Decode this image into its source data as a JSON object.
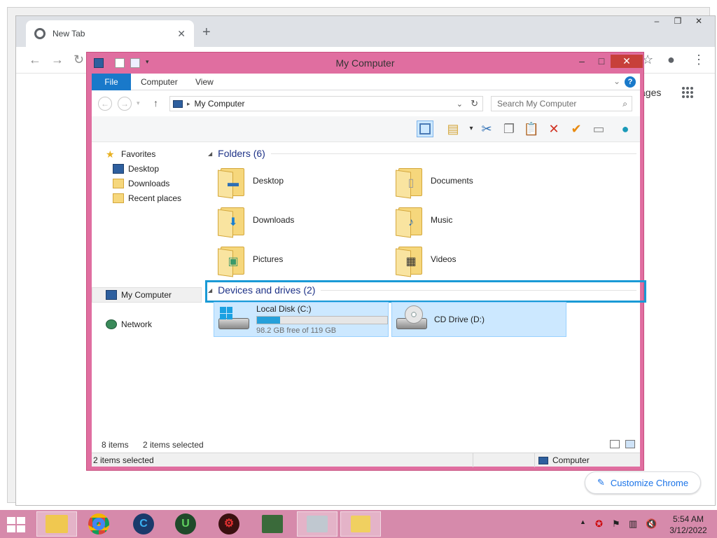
{
  "chrome": {
    "tab_title": "New Tab",
    "new_tab_symbol": "+",
    "gmail_partial": "ages",
    "customize_label": "Customize Chrome",
    "window_controls": [
      "–",
      "❐",
      "✕"
    ]
  },
  "explorer": {
    "title": "My Computer",
    "title_controls": {
      "minimize": "–",
      "maximize": "□",
      "close": "✕"
    },
    "ribbon_tabs": [
      "File",
      "Computer",
      "View"
    ],
    "help_label": "?",
    "address": {
      "location": "My Computer"
    },
    "search": {
      "placeholder": "Search My Computer"
    },
    "nav": {
      "favorites": "Favorites",
      "desktop": "Desktop",
      "downloads": "Downloads",
      "recent": "Recent places",
      "my_computer": "My Computer",
      "network": "Network"
    },
    "folders_header": "Folders (6)",
    "folders": [
      {
        "name": "Desktop",
        "icon": "desktop-folder-icon"
      },
      {
        "name": "Documents",
        "icon": "documents-folder-icon"
      },
      {
        "name": "Downloads",
        "icon": "downloads-folder-icon"
      },
      {
        "name": "Music",
        "icon": "music-folder-icon"
      },
      {
        "name": "Pictures",
        "icon": "pictures-folder-icon"
      },
      {
        "name": "Videos",
        "icon": "videos-folder-icon"
      }
    ],
    "devices_header": "Devices and drives (2)",
    "drives": [
      {
        "name": "Local Disk (C:)",
        "free": "98.2 GB free of 119 GB",
        "used_fraction": 0.175
      },
      {
        "name": "CD Drive (D:)"
      }
    ],
    "status": {
      "item_count": "8 items",
      "selected": "2 items selected",
      "bottom_selected": "2 items selected",
      "bottom_location": "Computer"
    }
  },
  "taskbar": {
    "apps": [
      "file-explorer",
      "chrome",
      "ccleaner",
      "app-u",
      "app-red",
      "app-window",
      "app-monitor",
      "app-network"
    ],
    "time": "5:54 AM",
    "date": "3/12/2022"
  },
  "colors": {
    "explorer_frame": "#e06ea0",
    "taskbar": "#d68aab",
    "selection": "#cce8ff",
    "highlight_box": "#1a9ad6",
    "file_tab": "#1979ca"
  }
}
